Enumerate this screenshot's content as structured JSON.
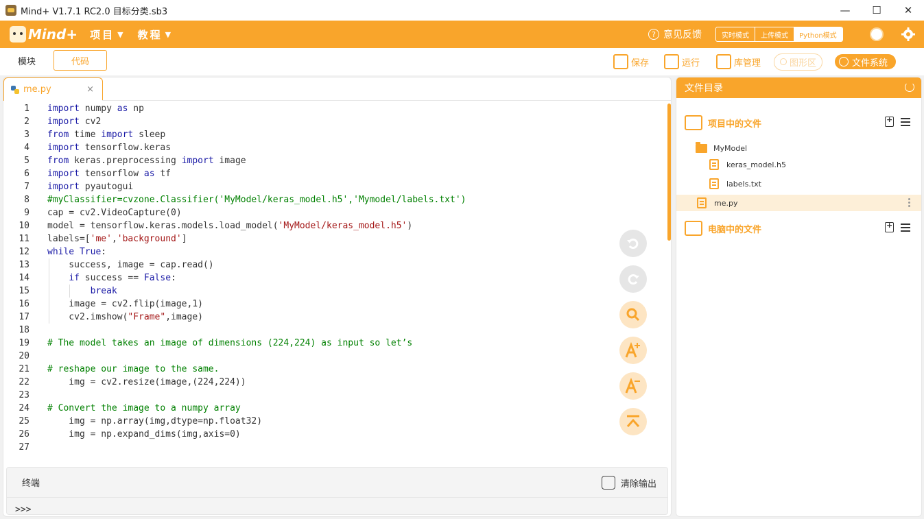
{
  "window": {
    "title": "Mind+ V1.7.1 RC2.0    目标分类.sb3",
    "controls": [
      "—",
      "☐",
      "✕"
    ]
  },
  "menubar": {
    "brand": "Mind+",
    "items": [
      {
        "label": "项目"
      },
      {
        "label": "教程"
      }
    ],
    "feedback": "意见反馈",
    "modes": [
      "实时模式",
      "上传模式",
      "Python模式"
    ],
    "selected_mode": "Python模式"
  },
  "toolbar": {
    "tabs": [
      "模块",
      "代码"
    ],
    "active_tab": "代码",
    "save": "保存",
    "run": "运行",
    "library": "库管理",
    "graphic": "图形区",
    "filesystem": "文件系统"
  },
  "editor": {
    "file_tab": "me.py",
    "close_glyph": "×",
    "lines": [
      "import numpy as np",
      "import cv2",
      "from time import sleep",
      "import tensorflow.keras",
      "from keras.preprocessing import image",
      "import tensorflow as tf",
      "import pyautogui",
      "#myClassifier=cvzone.Classifier('MyModel/keras_model.h5','Mymodel/labels.txt')",
      "cap = cv2.VideoCapture(0)",
      "model = tensorflow.keras.models.load_model('MyModel/keras_model.h5')",
      "labels=['me','background']",
      "while True:",
      "    success, image = cap.read()",
      "    if success == False:",
      "        break",
      "    image = cv2.flip(image,1)",
      "    cv2.imshow(\"Frame\",image)",
      "",
      "# The model takes an image of dimensions (224,224) as input so let’s",
      "",
      "# reshape our image to the same.",
      "    img = cv2.resize(image,(224,224))",
      "",
      "# Convert the image to a numpy array",
      "    img = np.array(img,dtype=np.float32)",
      "    img = np.expand_dims(img,axis=0)",
      ""
    ]
  },
  "terminal": {
    "title": "终端",
    "clear": "清除输出",
    "prompt": ">>>"
  },
  "sidebar": {
    "title": "文件目录",
    "project_files": "项目中的文件",
    "computer_files": "电脑中的文件",
    "tree": [
      {
        "name": "MyModel",
        "type": "folder"
      },
      {
        "name": "keras_model.h5",
        "type": "file"
      },
      {
        "name": "labels.txt",
        "type": "file"
      },
      {
        "name": "me.py",
        "type": "file",
        "selected": true
      }
    ]
  },
  "colors": {
    "accent": "#f9a52b",
    "keyword": "#1a1aa6",
    "string": "#a31515",
    "comment": "#008000"
  }
}
